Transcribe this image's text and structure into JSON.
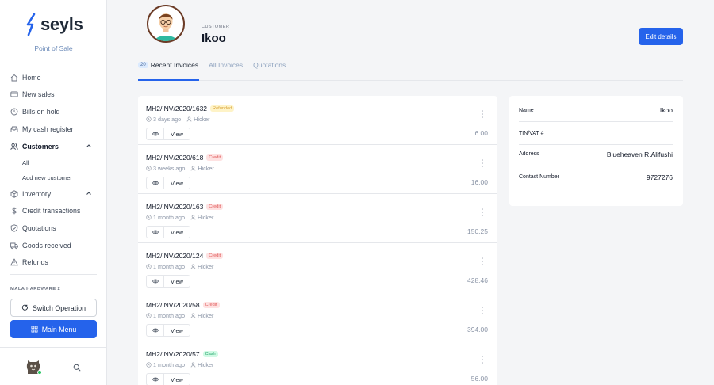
{
  "brand": {
    "name": "seyls",
    "subtitle": "Point of Sale",
    "accent": "#2563eb"
  },
  "sidebar": {
    "items": [
      {
        "label": "Home",
        "icon": "home-icon"
      },
      {
        "label": "New sales",
        "icon": "card-icon"
      },
      {
        "label": "Bills on hold",
        "icon": "clock-icon"
      },
      {
        "label": "My cash register",
        "icon": "register-icon"
      },
      {
        "label": "Customers",
        "icon": "users-icon"
      },
      {
        "label": "Inventory",
        "icon": "box-icon"
      },
      {
        "label": "Credit transactions",
        "icon": "dollar-icon"
      },
      {
        "label": "Quotations",
        "icon": "shield-icon"
      },
      {
        "label": "Goods received",
        "icon": "truck-icon"
      },
      {
        "label": "Refunds",
        "icon": "warning-icon"
      }
    ],
    "customers_sub": [
      "All",
      "Add new customer"
    ],
    "org_name": "MALA HARDWARE 2",
    "switch_label": "Switch Operation",
    "menu_label": "Main Menu"
  },
  "header": {
    "label": "CUSTOMER",
    "name": "Ikoo",
    "edit_label": "Edit details"
  },
  "tabs": {
    "recent_count": "20",
    "recent": "Recent Invoices",
    "all": "All Invoices",
    "quotations": "Quotations"
  },
  "invoices": [
    {
      "number": "MH2/INV/2020/1632",
      "status": "Refunded",
      "time": "3 days ago",
      "user": "Hicker",
      "amount": "6.00",
      "view": "View"
    },
    {
      "number": "MH2/INV/2020/618",
      "status": "Credit",
      "time": "3 weeks ago",
      "user": "Hicker",
      "amount": "16.00",
      "view": "View"
    },
    {
      "number": "MH2/INV/2020/163",
      "status": "Credit",
      "time": "1 month ago",
      "user": "Hicker",
      "amount": "150.25",
      "view": "View"
    },
    {
      "number": "MH2/INV/2020/124",
      "status": "Credit",
      "time": "1 month ago",
      "user": "Hicker",
      "amount": "428.46",
      "view": "View"
    },
    {
      "number": "MH2/INV/2020/58",
      "status": "Credit",
      "time": "1 month ago",
      "user": "Hicker",
      "amount": "394.00",
      "view": "View"
    },
    {
      "number": "MH2/INV/2020/57",
      "status": "Cash",
      "time": "1 month ago",
      "user": "Hicker",
      "amount": "56.00",
      "view": "View"
    }
  ],
  "details": [
    {
      "label": "Name",
      "value": "Ikoo"
    },
    {
      "label": "TIN/VAT #",
      "value": ""
    },
    {
      "label": "Address",
      "value": "Blueheaven R.Alifushi"
    },
    {
      "label": "Contact Number",
      "value": "9727276"
    }
  ]
}
